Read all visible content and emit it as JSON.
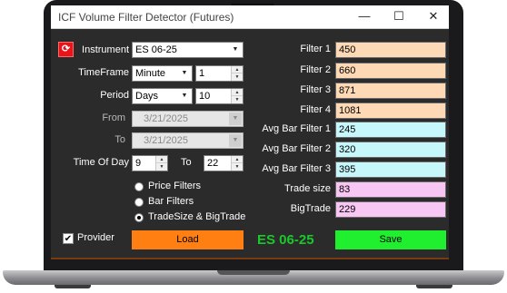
{
  "window": {
    "title": "ICF Volume Filter Detector (Futures)",
    "minimize_icon": "minimize-icon",
    "maximize_icon": "maximize-icon",
    "close_icon": "close-icon"
  },
  "left": {
    "refresh_icon": "refresh-icon",
    "instrument_label": "Instrument",
    "instrument_value": "ES 06-25",
    "timeframe_label": "TimeFrame",
    "timeframe_unit": "Minute",
    "timeframe_value": "1",
    "period_label": "Period",
    "period_unit": "Days",
    "period_value": "10",
    "from_label": "From",
    "from_value": "3/21/2025",
    "to_label": "To",
    "to_value": "3/21/2025",
    "time_of_day_label": "Time Of Day",
    "time_start": "9",
    "time_to_label": "To",
    "time_end": "22",
    "radio_options": [
      "Price Filters",
      "Bar Filters",
      "TradeSize & BigTrade"
    ],
    "radio_selected": "TradeSize & BigTrade",
    "provider_label": "Provider",
    "provider_checked": true,
    "load_label": "Load"
  },
  "center": {
    "symbol_display": "ES 06-25"
  },
  "filters": [
    {
      "label": "Filter 1",
      "value": "450",
      "color": "#fdd9b5"
    },
    {
      "label": "Filter 2",
      "value": "660",
      "color": "#fdd9b5"
    },
    {
      "label": "Filter 3",
      "value": "871",
      "color": "#fdd9b5"
    },
    {
      "label": "Filter 4",
      "value": "1081",
      "color": "#fdd9b5"
    },
    {
      "label": "Avg Bar Filter 1",
      "value": "245",
      "color": "#c6f7fb"
    },
    {
      "label": "Avg Bar Filter 2",
      "value": "320",
      "color": "#c6f7fb"
    },
    {
      "label": "Avg Bar Filter 3",
      "value": "395",
      "color": "#c6f7fb"
    },
    {
      "label": "Trade size",
      "value": "83",
      "color": "#f8c6f2"
    },
    {
      "label": "BigTrade",
      "value": "229",
      "color": "#f8c6f2"
    }
  ],
  "save_label": "Save",
  "colors": {
    "load_button": "#ff7f13",
    "save_button": "#1fef2e",
    "symbol_text": "#19c92b",
    "background": "#2b2b2b"
  }
}
